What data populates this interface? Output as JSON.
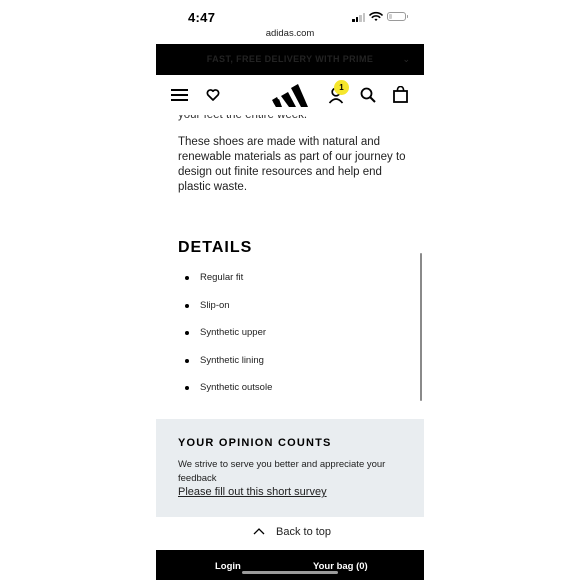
{
  "status_bar": {
    "time": "4:47",
    "url": "adidas.com",
    "icons": [
      "cellular-signal-icon",
      "wifi-icon",
      "battery-icon"
    ]
  },
  "promo_banner": {
    "text": "FAST, FREE DELIVERY WITH PRIME",
    "chevron_icon": "chevron-down-icon"
  },
  "header": {
    "icons": [
      "menu-icon",
      "wishlist-heart-icon",
      "adidas-logo",
      "account-icon",
      "search-icon",
      "bag-icon"
    ],
    "account_badge": "1",
    "badge_color": "#f5e62d"
  },
  "content": {
    "previous_line": "your feet the entire week.",
    "paragraph": "These shoes are made with natural and renewable materials as part of our journey to design out finite resources and help end plastic waste.",
    "details_title": "DETAILS",
    "details": [
      "Regular fit",
      "Slip-on",
      "Synthetic upper",
      "Synthetic lining",
      "Synthetic outsole"
    ]
  },
  "survey": {
    "title": "YOUR OPINION COUNTS",
    "text": "We strive to serve you better and appreciate your feedback",
    "link": "Please fill out this short survey",
    "background": "#e9edf0"
  },
  "back_to_top": {
    "label": "Back to top",
    "icon": "chevron-up-icon"
  },
  "footer": {
    "login": "Login",
    "bag": "Your bag (0)"
  }
}
